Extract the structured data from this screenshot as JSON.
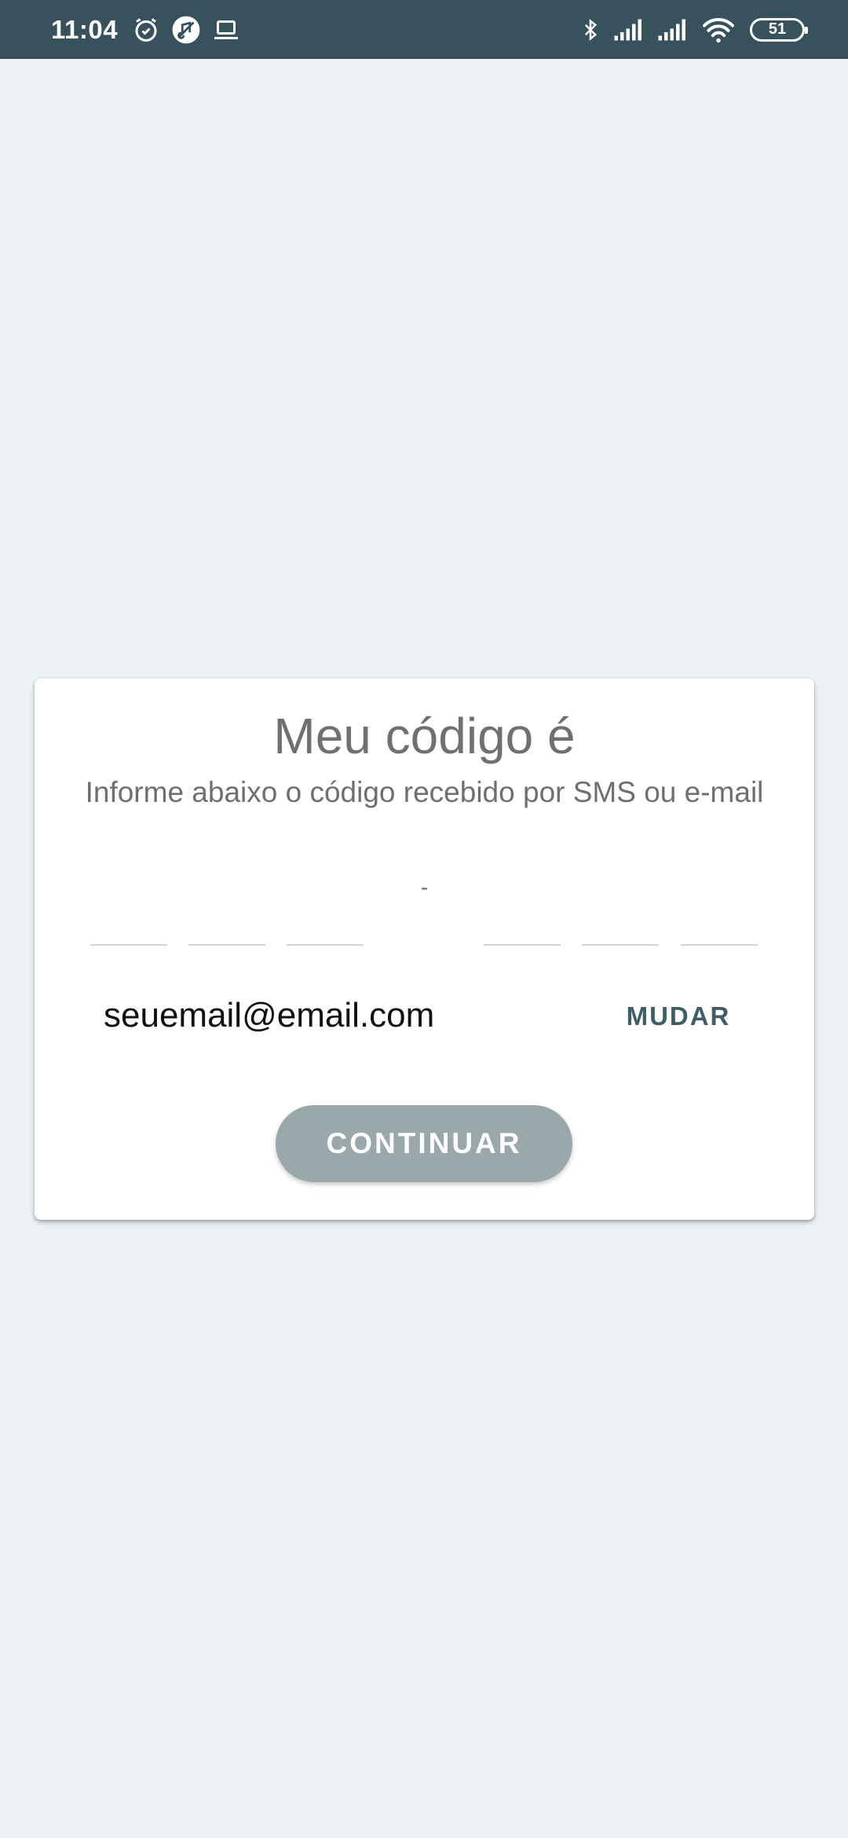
{
  "status_bar": {
    "time": "11:04",
    "battery_level": "51",
    "left_icons": [
      "alarm-icon",
      "music-off-icon",
      "laptop-icon"
    ],
    "right_icons": [
      "bluetooth-icon",
      "signal-icon",
      "signal-icon",
      "wifi-icon",
      "battery-icon"
    ],
    "background_color": "#37525c"
  },
  "card": {
    "title": "Meu código é",
    "subtitle": "Informe abaixo o código recebido por SMS ou e-mail",
    "code_separator": "-",
    "code_fields": [
      "",
      "",
      "",
      "",
      "",
      ""
    ],
    "email": "seuemail@email.com",
    "change_label": "MUDAR",
    "continue_label": "CONTINUAR"
  },
  "colors": {
    "background": "#ecf0f3",
    "accent": "#3f5d66",
    "button_disabled": "#9aa8ac"
  }
}
